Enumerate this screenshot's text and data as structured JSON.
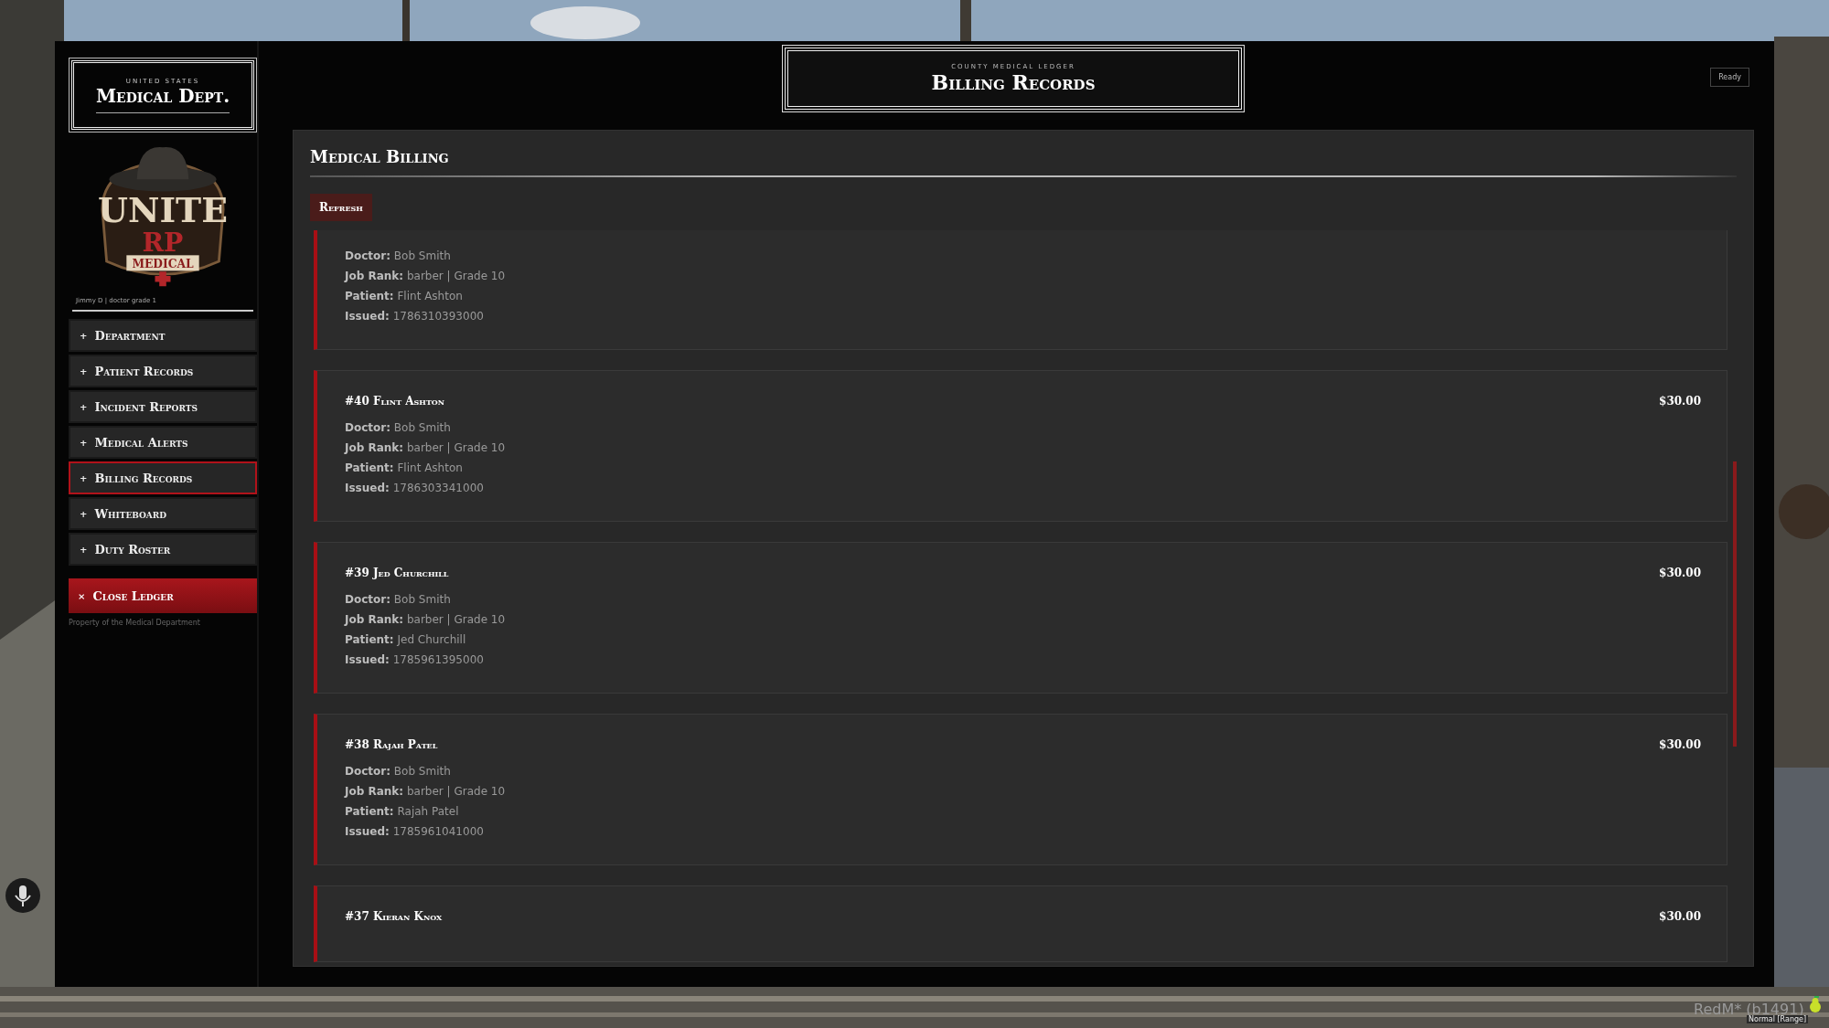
{
  "sidebar": {
    "brand": {
      "overline": "UNITED STATES",
      "title": "Medical Dept."
    },
    "logo": {
      "title": "UNITE",
      "subtitle": "RP",
      "banner": "MEDICAL"
    },
    "user": "Jimmy D | doctor grade 1",
    "items": [
      {
        "marker": "+",
        "label": "Department",
        "selected": false
      },
      {
        "marker": "+",
        "label": "Patient Records",
        "selected": false
      },
      {
        "marker": "+",
        "label": "Incident Reports",
        "selected": false
      },
      {
        "marker": "+",
        "label": "Medical Alerts",
        "selected": false
      },
      {
        "marker": "+",
        "label": "Billing Records",
        "selected": true
      },
      {
        "marker": "+",
        "label": "Whiteboard",
        "selected": false
      },
      {
        "marker": "+",
        "label": "Duty Roster",
        "selected": false
      }
    ],
    "close_button": {
      "icon": "×",
      "label": "Close Ledger"
    },
    "footer": "Property of the Medical Department"
  },
  "header": {
    "overline": "COUNTY MEDICAL LEDGER",
    "title": "Billing Records",
    "status": "Ready"
  },
  "panel": {
    "title": "Medical Billing",
    "refresh_button": "Refresh",
    "bills": [
      {
        "details": [
          "**Doctor:** Bob Smith",
          "**Job Rank:** barber | Grade 10",
          "**Patient:** Flint Ashton",
          "**Issued:** 1786310393000"
        ]
      },
      {
        "title": "#40 Flint Ashton",
        "amount": "$30.00",
        "details": [
          "**Doctor:** Bob Smith",
          "**Job Rank:** barber | Grade 10",
          "**Patient:** Flint Ashton",
          "**Issued:** 1786303341000"
        ]
      },
      {
        "title": "#39 Jed Churchill",
        "amount": "$30.00",
        "details": [
          "**Doctor:** Bob Smith",
          "**Job Rank:** barber | Grade 10",
          "**Patient:** Jed Churchill",
          "**Issued:** 1785961395000"
        ]
      },
      {
        "title": "#38 Rajah Patel",
        "amount": "$30.00",
        "details": [
          "**Doctor:** Bob Smith",
          "**Job Rank:** barber | Grade 10",
          "**Patient:** Rajah Patel",
          "**Issued:** 1785961041000"
        ]
      },
      {
        "title": "#37 Kieran Knox",
        "amount": "$30.00"
      }
    ]
  },
  "overlay": {
    "client": "RedM* (b1491)",
    "voice_mode": "Normal [Range]"
  }
}
